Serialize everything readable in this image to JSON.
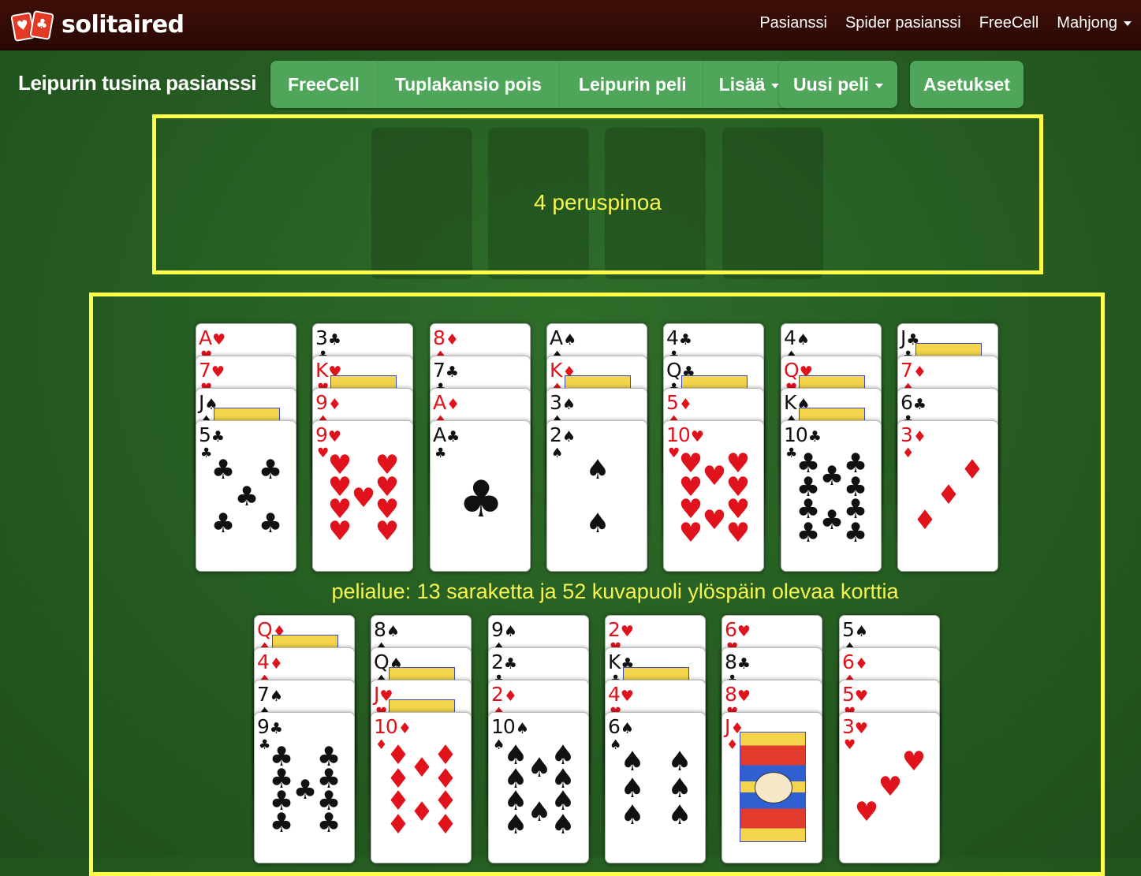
{
  "brand": {
    "logo_text": "solitaired",
    "logo_suits": [
      "♥",
      "♣"
    ]
  },
  "topnav": {
    "items": [
      {
        "label": "Pasianssi"
      },
      {
        "label": "Spider pasianssi"
      },
      {
        "label": "FreeCell"
      },
      {
        "label": "Mahjong",
        "dropdown": true
      }
    ]
  },
  "toolbar": {
    "title": "Leipurin tusina pasianssi",
    "game_links": [
      {
        "label": "FreeCell"
      },
      {
        "label": "Tuplakansio pois"
      },
      {
        "label": "Leipurin peli"
      },
      {
        "label": "Lisää",
        "dropdown": true
      }
    ],
    "new_game_label": "Uusi peli",
    "settings_label": "Asetukset"
  },
  "annotations": {
    "foundations_label": "4 peruspinoa",
    "tableau_label": "pelialue: 13 saraketta ja 52 kuvapuoli ylöspäin olevaa korttia",
    "color": "#ffff4a"
  },
  "foundations": {
    "count": 4
  },
  "tableau": {
    "rows": [
      [
        [
          "A♥",
          "7♥",
          "J♠",
          "5♣"
        ],
        [
          "3♣",
          "K♥",
          "9♦",
          "9♥"
        ],
        [
          "8♦",
          "7♣",
          "A♦",
          "A♣"
        ],
        [
          "A♠",
          "K♦",
          "3♠",
          "2♠"
        ],
        [
          "4♣",
          "Q♣",
          "5♦",
          "10♥"
        ],
        [
          "4♠",
          "Q♥",
          "K♠",
          "10♣"
        ],
        [
          "J♣",
          "7♦",
          "6♣",
          "3♦"
        ]
      ],
      [
        [
          "Q♦",
          "4♦",
          "7♠",
          "9♣"
        ],
        [
          "8♠",
          "Q♠",
          "J♥",
          "10♦"
        ],
        [
          "9♠",
          "2♣",
          "2♦",
          "10♠"
        ],
        [
          "2♥",
          "K♣",
          "4♥",
          "6♠"
        ],
        [
          "6♥",
          "8♣",
          "8♥",
          "J♦"
        ],
        [
          "5♠",
          "6♦",
          "5♥",
          "3♥"
        ]
      ]
    ]
  },
  "colors": {
    "felt": "#275f23",
    "topbar": "#3a0d06",
    "button": "#4fa65a",
    "red_suit": "#e0121c",
    "black_suit": "#111111"
  }
}
